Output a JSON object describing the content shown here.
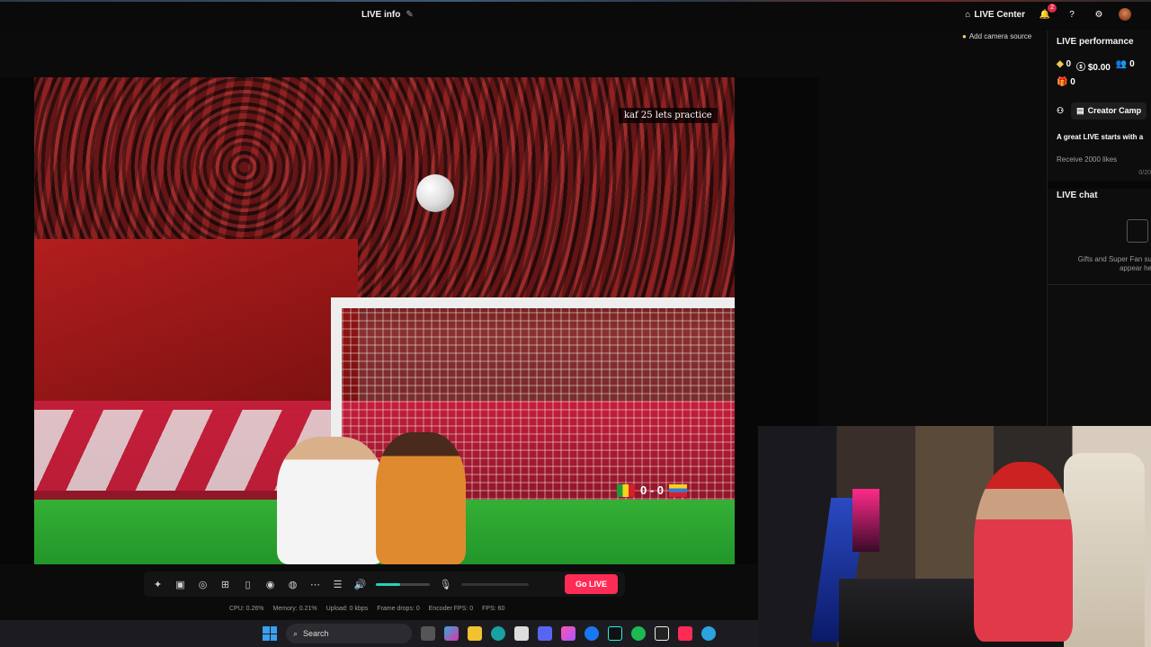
{
  "header": {
    "live_info": "LIVE info",
    "live_center": "LIVE Center",
    "notification_count": "2"
  },
  "camera": {
    "add_source": "Add camera source"
  },
  "video": {
    "overlay_text": "kaf 25 lets practice",
    "score": "0 - 0"
  },
  "controls": {
    "go_live": "Go LIVE",
    "volume_level": 0.45
  },
  "stats": {
    "cpu": "CPU: 0.26%",
    "memory": "Memory: 0.21%",
    "upload": "Upload: 0 kbps",
    "frame_drops": "Frame drops: 0",
    "encoder_fps": "Encoder FPS: 0",
    "fps": "FPS: 60"
  },
  "side": {
    "performance_title": "LIVE performance",
    "diamonds": "0",
    "earnings": "$0.00",
    "viewers": "0",
    "gifts": "0",
    "creator_camp": "Creator Camp",
    "great_live": "A great LIVE starts with a",
    "receive_likes": "Receive 2000 likes",
    "likes_progress": "0/20",
    "chat_title": "LIVE chat",
    "chat_empty": "Gifts and Super Fan su appear he"
  },
  "taskbar": {
    "search": "Search"
  },
  "colors": {
    "accent": "#fe2c55",
    "volume": "#25d3b8"
  }
}
